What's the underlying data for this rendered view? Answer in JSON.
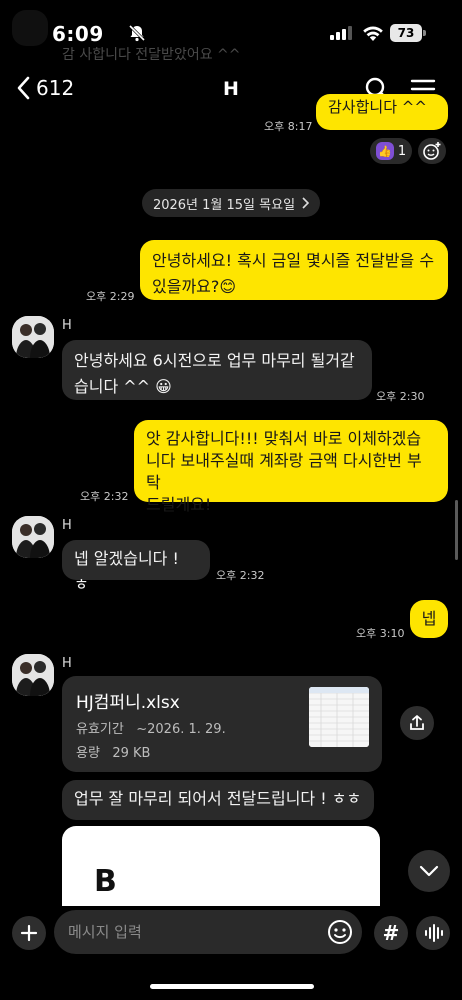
{
  "status": {
    "time": "6:09",
    "battery": "73"
  },
  "ghost_text": "감 사합니다 전달받았어요 ^^",
  "nav": {
    "back_count": "612",
    "title": "H"
  },
  "top_partial": {
    "text": "감사합니다 ^^",
    "time": "오후 8:17"
  },
  "reaction": {
    "count": "1"
  },
  "date_divider": "2026년 1월 15일 목요일",
  "messages": [
    {
      "from": "me",
      "lines": [
        "안녕하세요! 혹시 금일 몇시즐 전달받을 수",
        "있을까요?😊"
      ],
      "time": "오후 2:29"
    },
    {
      "from": "H",
      "sender": "H",
      "lines": [
        "안녕하세요 6시전으로 업무 마무리 될거같",
        "습니다 ^^ 😀"
      ],
      "time": "오후 2:30"
    },
    {
      "from": "me",
      "lines": [
        "앗 감사합니다!!! 맞춰서 바로 이체하겠습",
        "니다 보내주실때 계좌랑 금액 다시한번 부탁",
        "드릴게요!"
      ],
      "time": "오후 2:32"
    },
    {
      "from": "H",
      "sender": "H",
      "lines": [
        "넵 알겠습니다 ! ㅎ"
      ],
      "time": "오후 2:32"
    },
    {
      "from": "me",
      "lines": [
        "넵"
      ],
      "time": "오후 3:10"
    },
    {
      "from": "H",
      "sender": "H",
      "lines": [
        "업무 잘 마무리 되어서 전달드립니다 ! ㅎㅎ"
      ]
    }
  ],
  "file": {
    "name": "HJ컴퍼니.xlsx",
    "expiry_label": "유효기간",
    "expiry_value": "~2026. 1. 29.",
    "size_label": "용량",
    "size_value": "29 KB"
  },
  "image_preview": {
    "logo": "B"
  },
  "input": {
    "placeholder": "메시지 입력"
  },
  "colors": {
    "my_bubble": "#fee500",
    "their_bubble": "#2a2a2a",
    "background": "#000000"
  }
}
